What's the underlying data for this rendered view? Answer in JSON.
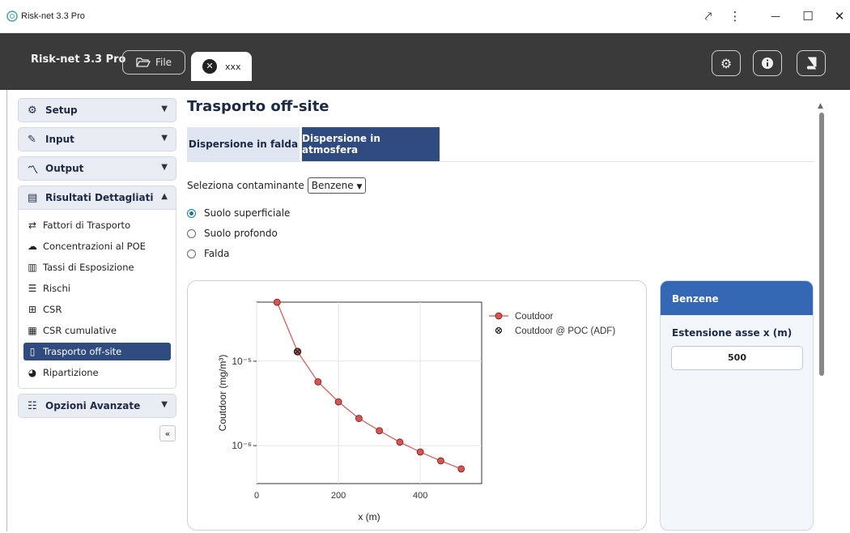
{
  "window": {
    "title": "Risk-net 3.3 Pro",
    "controls": {
      "ext": "⤤",
      "menu": "⋮",
      "minimize": "—",
      "maximize": "☐",
      "close": "✕"
    }
  },
  "appbar": {
    "brand": "Risk-net 3.3 Pro",
    "file_label": "File",
    "doc_tab": "xxx"
  },
  "sidebar": {
    "sections": [
      {
        "label": "Setup",
        "icon": "gear-icon"
      },
      {
        "label": "Input",
        "icon": "edit-icon"
      },
      {
        "label": "Output",
        "icon": "chart-line-icon"
      },
      {
        "label": "Risultati Dettagliati",
        "icon": "table-icon",
        "open": true
      }
    ],
    "sub_items": [
      {
        "label": "Fattori di Trasporto",
        "icon": "arrows-icon"
      },
      {
        "label": "Concentrazioni al POE",
        "icon": "cloud-upload-icon"
      },
      {
        "label": "Tassi di Esposizione",
        "icon": "bar-chart-icon"
      },
      {
        "label": "Rischi",
        "icon": "list-icon"
      },
      {
        "label": "CSR",
        "icon": "grid-icon"
      },
      {
        "label": "CSR cumulative",
        "icon": "calculator-icon"
      },
      {
        "label": "Trasporto off-site",
        "icon": "map-icon",
        "active": true
      },
      {
        "label": "Ripartizione",
        "icon": "pie-icon"
      }
    ],
    "advanced": {
      "label": "Opzioni Avanzate",
      "icon": "sliders-icon"
    },
    "collapse": "«"
  },
  "main": {
    "title": "Trasporto off-site",
    "tabs": [
      "Dispersione in falda",
      "Dispersione in atmosfera"
    ],
    "active_tab": 1,
    "contaminant_label": "Seleziona contaminante",
    "contaminant_value": "Benzene",
    "radios": [
      {
        "label": "Suolo superficiale",
        "checked": true
      },
      {
        "label": "Suolo profondo",
        "checked": false
      },
      {
        "label": "Falda",
        "checked": false
      }
    ]
  },
  "side_card": {
    "header": "Benzene",
    "axis_label": "Estensione asse x (m)",
    "axis_value": "500"
  },
  "chart_data": {
    "type": "line",
    "xlabel": "x (m)",
    "ylabel": "Coutdoor (mg/m³)",
    "x_ticks": [
      "0",
      "200",
      "400"
    ],
    "y_ticks": [
      "10⁻⁵",
      "10⁻⁶"
    ],
    "xlim": [
      0,
      550
    ],
    "ylim_log10": [
      -6.45,
      -4.3
    ],
    "y_scale": "log",
    "grid": true,
    "legend_position": "right",
    "series": [
      {
        "name": "Coutdoor",
        "marker": "circle",
        "color": "#d9534f",
        "x": [
          50,
          100,
          150,
          200,
          250,
          300,
          350,
          400,
          450,
          500
        ],
        "y": [
          5e-05,
          1.3e-05,
          5.7e-06,
          3.3e-06,
          2.1e-06,
          1.5e-06,
          1.1e-06,
          8.4e-07,
          6.6e-07,
          5.3e-07
        ]
      },
      {
        "name": "Coutdoor @ POC (ADF)",
        "marker": "circle-x",
        "color": "#222222",
        "x": [
          100
        ],
        "y": [
          1.3e-05
        ]
      }
    ]
  }
}
